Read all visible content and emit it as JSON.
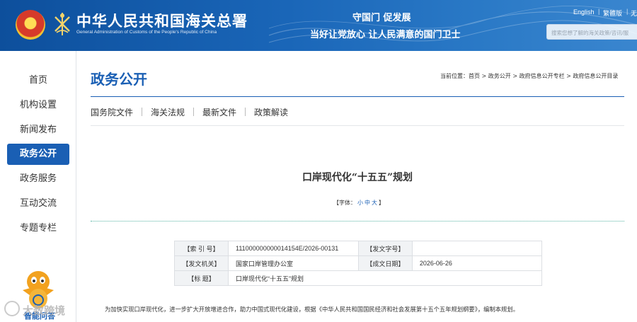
{
  "header": {
    "site_title": "中华人民共和国海关总署",
    "site_subtitle": "General Administration of Customs of the People's Republic of China",
    "slogan_1": "守国门  促发展",
    "slogan_2": "当好让党放心   让人民满意的国门卫士",
    "lang_english": "English",
    "lang_traditional": "繁體版",
    "lang_other": "无",
    "search_placeholder": "搜索您想了解的海关政策/咨讯/服"
  },
  "sidebar": {
    "items": [
      {
        "label": "首页",
        "active": false
      },
      {
        "label": "机构设置",
        "active": false
      },
      {
        "label": "新闻发布",
        "active": false
      },
      {
        "label": "政务公开",
        "active": true
      },
      {
        "label": "政务服务",
        "active": false
      },
      {
        "label": "互动交流",
        "active": false
      },
      {
        "label": "专题专栏",
        "active": false
      }
    ],
    "mascot_label": "智能问答",
    "watermark": "大数跨境"
  },
  "main": {
    "page_title": "政务公开",
    "breadcrumb": "当前位置：首页 > 政务公开 > 政府信息公开专栏 > 政府信息公开目录",
    "tabs": [
      "国务院文件",
      "海关法规",
      "最新文件",
      "政策解读"
    ],
    "doc_title": "口岸现代化“十五五”规划",
    "font_size": {
      "prefix": "【字体：",
      "small": "小",
      "medium": "中",
      "large": "大",
      "suffix": "】"
    },
    "meta": {
      "index_label": "【索 引 号】",
      "index_value": "111000000000014154E/2026-00131",
      "doc_no_label": "【发文字号】",
      "doc_no_value": "",
      "issuer_label": "【发文机关】",
      "issuer_value": "国家口岸管理办公室",
      "date_label": "【成文日期】",
      "date_value": "2026-06-26",
      "title_label": "【标      题】",
      "title_value": "口岸现代化“十五五”规划"
    },
    "body_first_line": "为加快实现口岸现代化，进一步扩大开放增进合作，助力中国式现代化建设，根据《中华人民共和国国民经济和社会发展第十五个五年规划纲要》，编制本规划。"
  },
  "colors": {
    "header_blue": "#0d4f9c",
    "accent_blue": "#1a5fb4",
    "divider_green": "#59b5a4"
  }
}
